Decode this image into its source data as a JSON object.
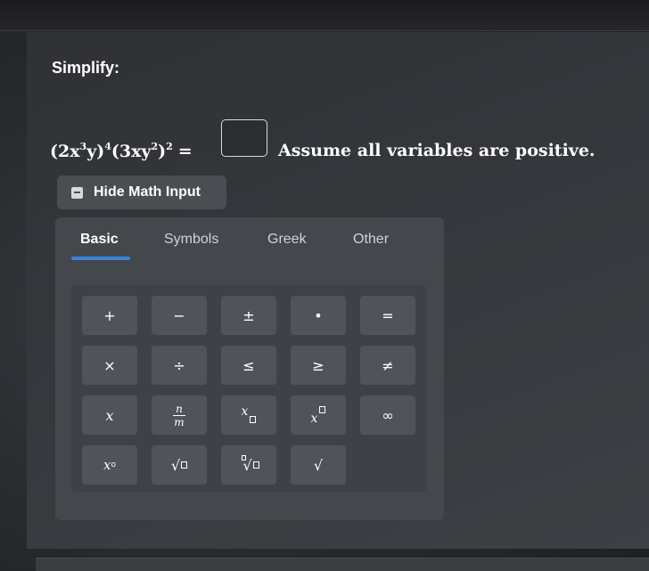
{
  "question": {
    "prompt": "Simplify:",
    "expression": {
      "open1": "(2x",
      "exp1": "3",
      "y1": "y)",
      "exp2": "4",
      "open2": "(3xy",
      "exp3": "2",
      "close2": ")",
      "exp4": "2",
      "equals": "="
    },
    "answer_value": "",
    "note": "Assume all variables are positive."
  },
  "math_input": {
    "toggle_label": "Hide Math Input",
    "tabs": [
      {
        "label": "Basic",
        "active": true
      },
      {
        "label": "Symbols",
        "active": false
      },
      {
        "label": "Greek",
        "active": false
      },
      {
        "label": "Other",
        "active": false
      }
    ],
    "keys": {
      "row1": [
        "+",
        "−",
        "±",
        "•",
        "="
      ],
      "row2": [
        "×",
        "÷",
        "≤",
        "≥",
        "≠"
      ],
      "row3_x": "x",
      "frac_num": "n",
      "frac_den": "m",
      "subscript_base": "x",
      "superscript_base": "x",
      "infinity": "∞",
      "degree_base": "x",
      "degree_sup": "o",
      "sqrt_symbol": "√",
      "nthroot_symbol": "√",
      "check_symbol": "√"
    }
  },
  "colors": {
    "tab_active_underline": "#3b82d6",
    "key_background": "#50535a"
  }
}
